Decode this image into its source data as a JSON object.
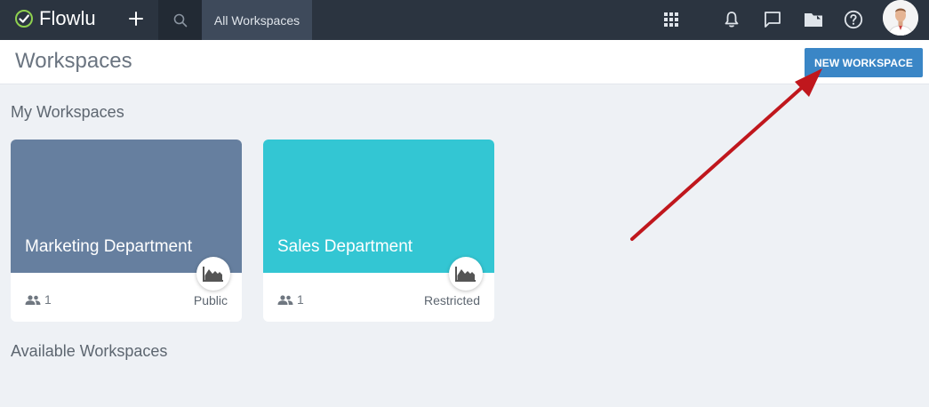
{
  "app": {
    "name": "Flowlu"
  },
  "topbar": {
    "active_tab": "All Workspaces",
    "icons": [
      "plus-icon",
      "search-icon",
      "apps-grid-icon",
      "bell-icon",
      "chat-icon",
      "folder-icon",
      "help-icon"
    ]
  },
  "header": {
    "title": "Workspaces",
    "new_button": "NEW WORKSPACE"
  },
  "sections": {
    "my": "My Workspaces",
    "available": "Available Workspaces"
  },
  "workspaces": [
    {
      "name": "Marketing Department",
      "members": "1",
      "access": "Public",
      "color": "#667f9f"
    },
    {
      "name": "Sales Department",
      "members": "1",
      "access": "Restricted",
      "color": "#33c6d3"
    }
  ],
  "colors": {
    "topbar": "#2b3440",
    "accent": "#3a86c6",
    "logo_check": "#8fd14f",
    "annotation_arrow": "#c0171d"
  }
}
